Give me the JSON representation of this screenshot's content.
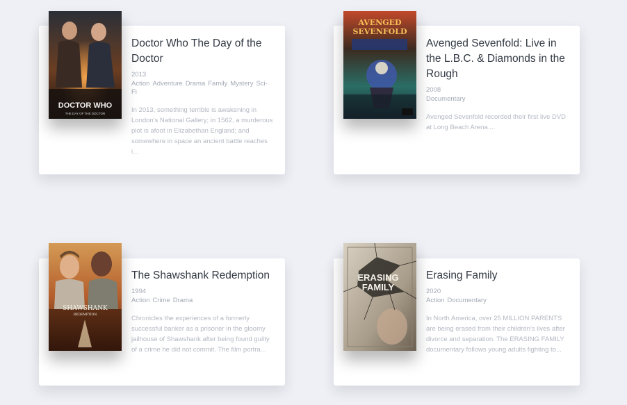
{
  "movies": [
    {
      "title": "Doctor Who The Day of the Doctor",
      "year": "2013",
      "genres": [
        "Action",
        "Adventure",
        "Drama",
        "Family",
        "Mystery",
        "Sci-Fi"
      ],
      "description": "In 2013, something terrible is awakening in London's National Gallery; in 1562, a murderous plot is afoot in Elizabethan England; and somewhere in space an ancient battle reaches i...",
      "poster": {
        "text_top": "DOCTOR WHO",
        "text_bottom": "THE DAY OF THE DOCTOR"
      }
    },
    {
      "title": "Avenged Sevenfold: Live in the L.B.C. & Diamonds in the Rough",
      "year": "2008",
      "genres": [
        "Documentary"
      ],
      "description": "Avenged Sevenfold recorded their first live DVD at Long Beach Arena....",
      "poster": {
        "text_top": "AVENGED SEVENFOLD"
      }
    },
    {
      "title": "The Shawshank Redemption",
      "year": "1994",
      "genres": [
        "Action",
        "Crime",
        "Drama"
      ],
      "description": "Chronicles the experiences of a formerly successful banker as a prisoner in the gloomy jailhouse of Shawshank after being found guilty of a crime he did not commit. The film portra...",
      "poster": {
        "text_top": "SHAWSHANK",
        "text_bottom": "REDEMPTION"
      }
    },
    {
      "title": "Erasing Family",
      "year": "2020",
      "genres": [
        "Action",
        "Documentary"
      ],
      "description": "In North America, over 25 MILLION PARENTS are being erased from their children's lives after divorce and separation. The ERASING FAMILY documentary follows young adults fighting to...",
      "poster": {
        "text_top": "ERASING",
        "text_bottom": "FAMILY"
      }
    }
  ]
}
